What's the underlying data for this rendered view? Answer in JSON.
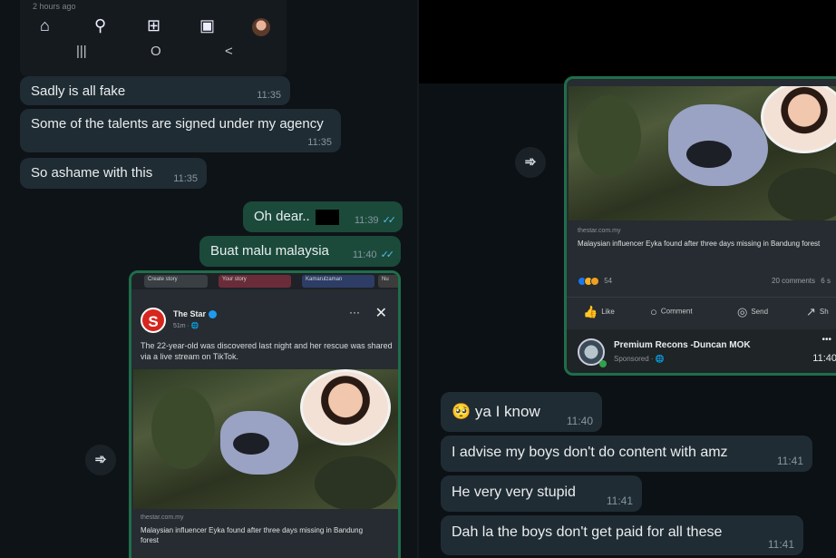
{
  "left": {
    "phone": {
      "hint": "2 hours ago",
      "nav_icons": [
        "home-icon",
        "search-icon",
        "add-post-icon",
        "reels-icon",
        "profile-avatar"
      ],
      "system_nav": [
        "|||",
        "O",
        "<"
      ]
    },
    "messages": [
      {
        "text": "Sadly is all fake",
        "time": "11:35",
        "dir": "in"
      },
      {
        "text": "Some of the talents are signed under my agency",
        "time": "11:35",
        "dir": "in"
      },
      {
        "text": "So ashame with this",
        "time": "11:35",
        "dir": "in"
      },
      {
        "text": "Oh dear..",
        "time": "11:39",
        "dir": "out"
      },
      {
        "text": "Buat malu malaysia",
        "time": "11:40",
        "dir": "out"
      }
    ],
    "card": {
      "stories": [
        "Create story",
        "Your story",
        "Kamarulzaman",
        "Nu"
      ],
      "source": "The Star",
      "meta": "51m · 🌐",
      "caption": "The 22-year-old was discovered last night and her rescue was shared via a live stream on TikTok.",
      "link_source": "thestar.com.my",
      "link_title": "Malaysian influencer Eyka found after three days missing in Bandung forest",
      "more": "···",
      "close": "✕"
    }
  },
  "right": {
    "card": {
      "link_source": "thestar.com.my",
      "link_title": "Malaysian influencer Eyka found after three days missing in Bandung forest",
      "reactions_count": "54",
      "comments": "20 comments",
      "shares": "6 s",
      "actions": [
        "Like",
        "Comment",
        "Send",
        "Sh"
      ],
      "sponsor_name": "Premium Recons -Duncan MOK",
      "sponsor_meta": "Sponsored · 🌐",
      "sponsor_time": "11:40",
      "more": "•••"
    },
    "messages": [
      {
        "emoji": "🥺",
        "text": "ya I know",
        "time": "11:40"
      },
      {
        "text": "I advise my boys don't do content with amz",
        "time": "11:41"
      },
      {
        "text": "He very very stupid",
        "time": "11:41"
      },
      {
        "text": "Dah la the boys don't get paid for all these",
        "time": "11:41"
      }
    ]
  },
  "icons": {
    "forward": "forward-icon",
    "ticks": "✓✓"
  },
  "colors": {
    "incoming": "#202c33",
    "outgoing": "#1b4a3a",
    "ticks": "#53bdeb",
    "card_border": "#1f6e4a",
    "background": "#0e1317"
  }
}
